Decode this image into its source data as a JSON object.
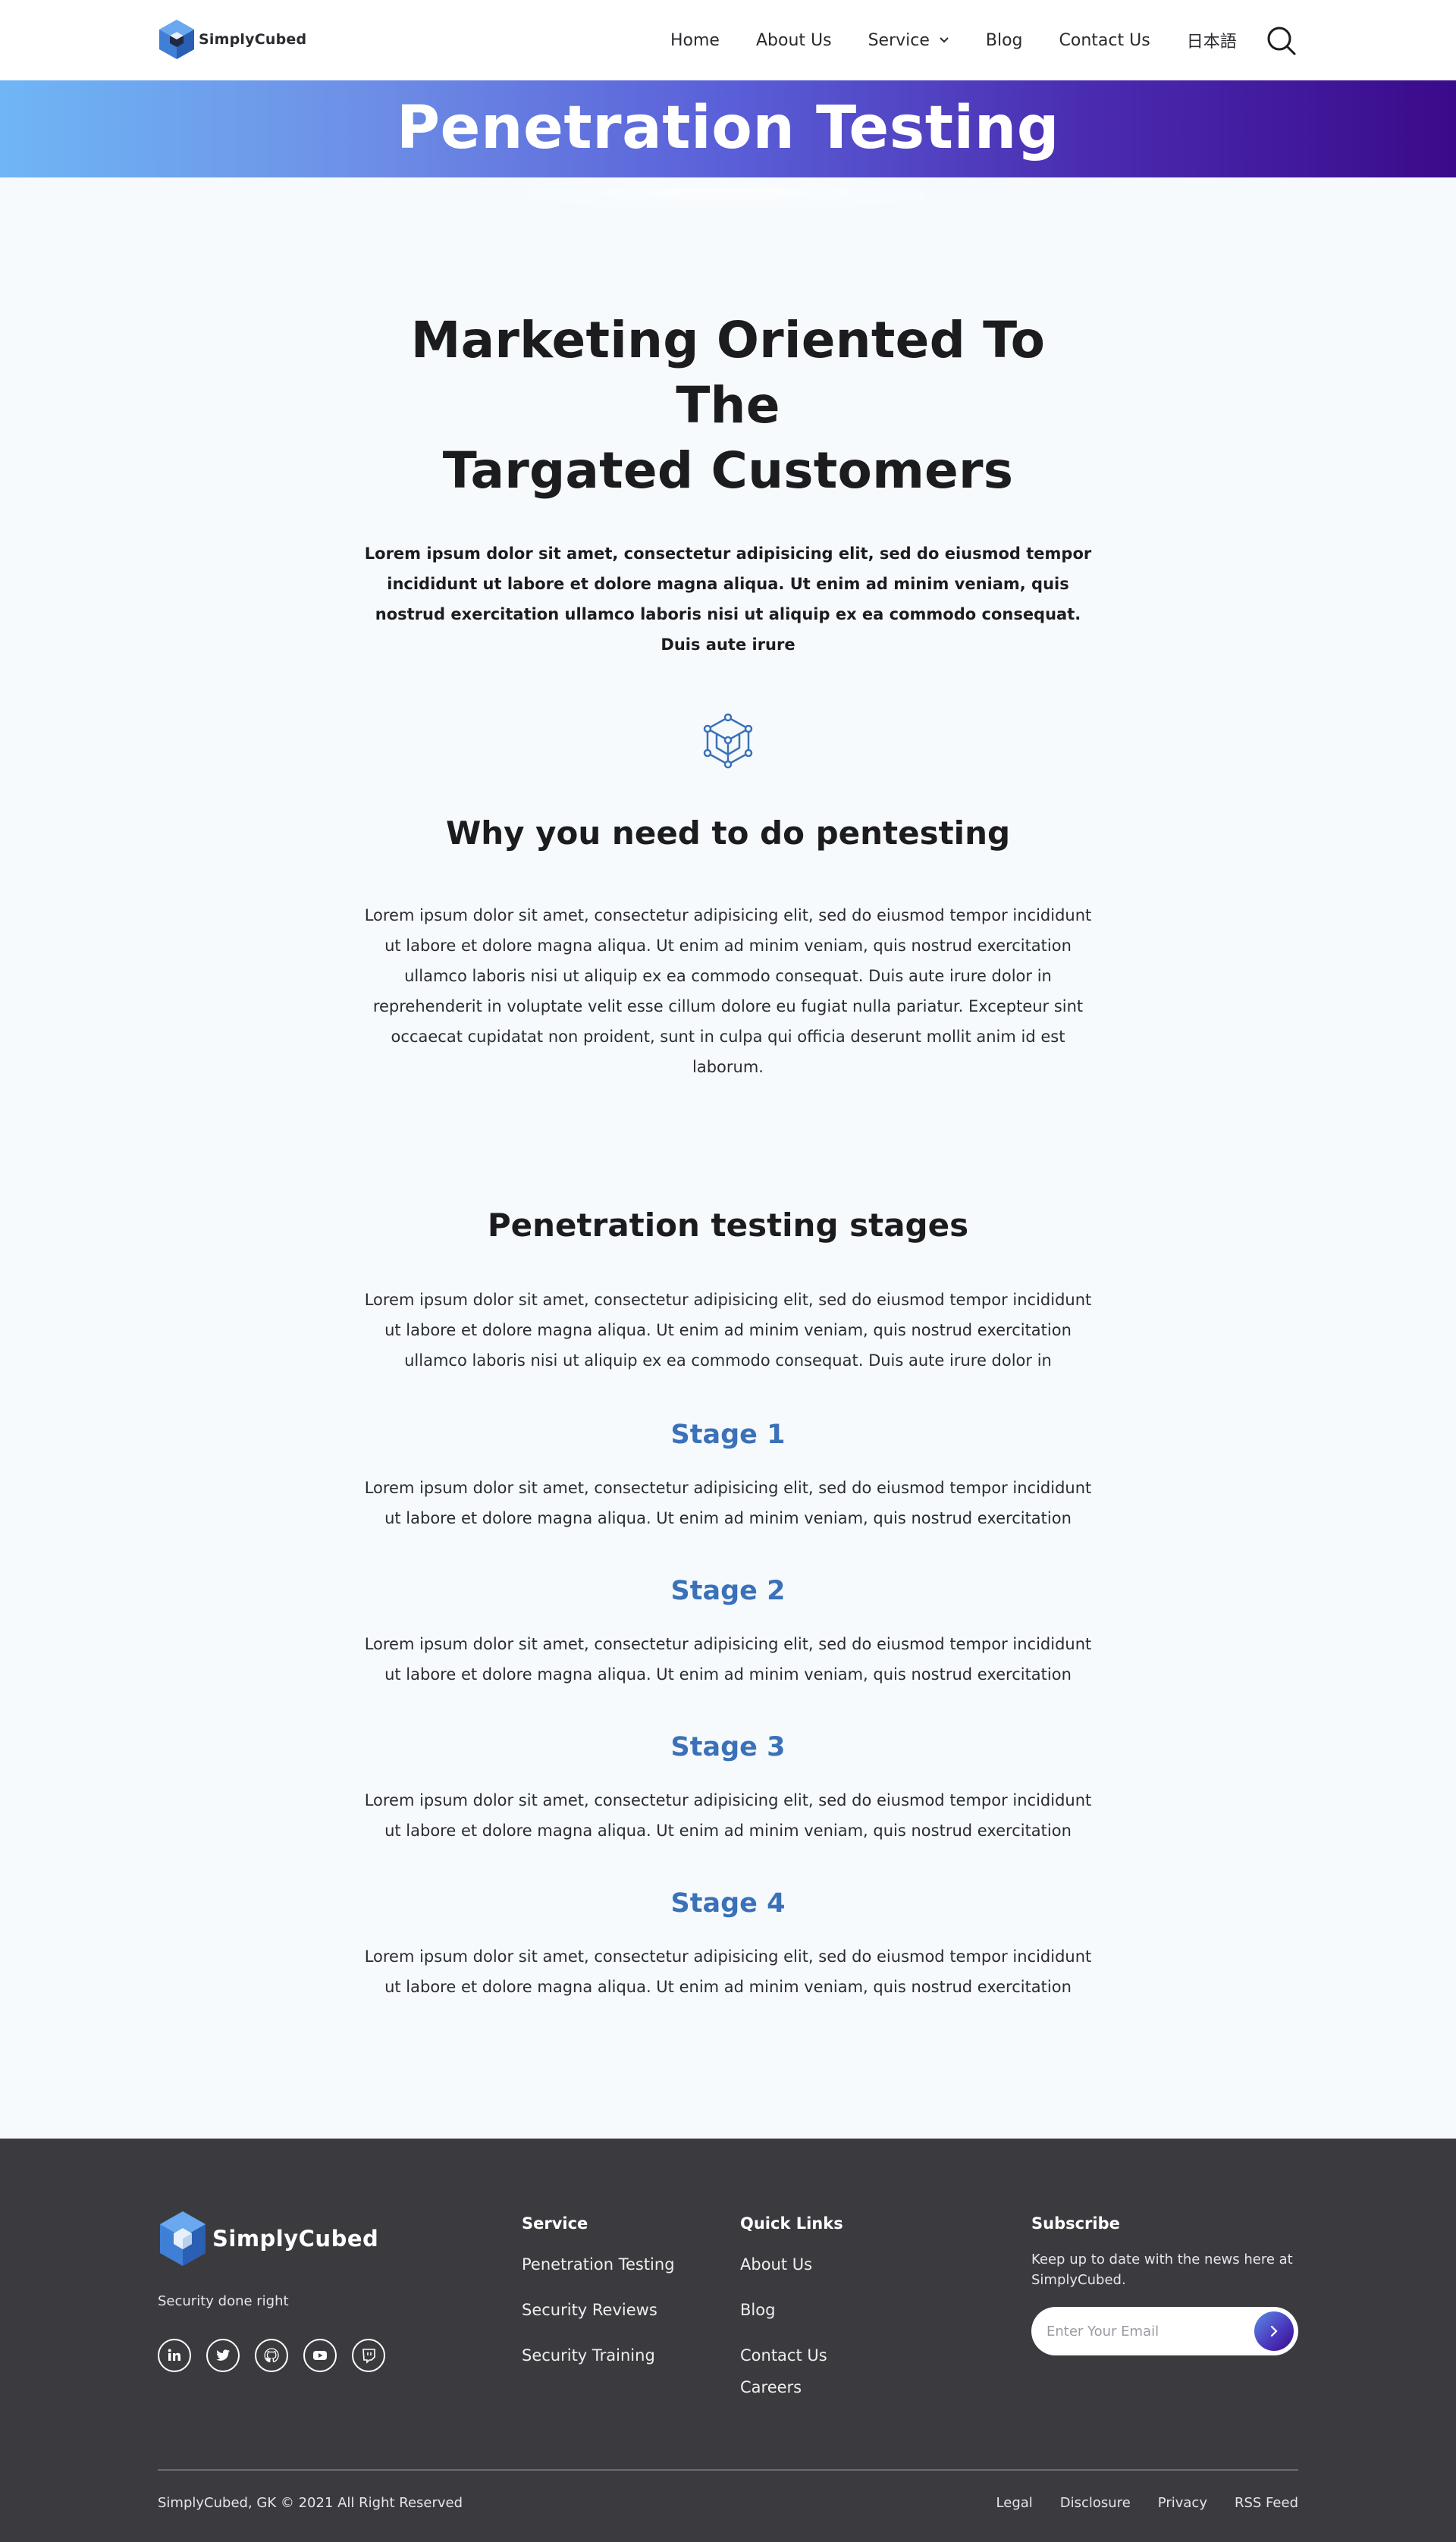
{
  "header": {
    "logo_text": "SimplyCubed",
    "nav": [
      {
        "label": "Home"
      },
      {
        "label": "About Us"
      },
      {
        "label": "Service"
      },
      {
        "label": "Blog"
      },
      {
        "label": "Contact Us"
      },
      {
        "label": "日本語"
      }
    ]
  },
  "hero": {
    "title": "Penetration Testing"
  },
  "intro": {
    "heading_line1": "Marketing Oriented To The",
    "heading_line2": "Targated Customers",
    "lead": "Lorem ipsum dolor sit amet, consectetur adipisicing elit, sed do eiusmod tempor incididunt ut labore et dolore magna aliqua. Ut enim ad minim veniam, quis nostrud exercitation ullamco laboris nisi ut aliquip ex ea commodo consequat. Duis aute irure"
  },
  "why": {
    "heading": "Why you need to do pentesting",
    "body": "Lorem ipsum dolor sit amet, consectetur adipisicing elit, sed do eiusmod tempor incididunt ut labore et dolore magna aliqua. Ut enim ad minim veniam, quis nostrud exercitation ullamco laboris nisi ut aliquip ex ea commodo consequat. Duis aute irure dolor in reprehenderit in voluptate velit esse cillum dolore eu fugiat nulla pariatur. Excepteur sint occaecat cupidatat non proident, sunt in culpa qui officia deserunt mollit anim id est laborum."
  },
  "stages": {
    "heading": "Penetration testing stages",
    "body": "Lorem ipsum dolor sit amet, consectetur adipisicing elit, sed do eiusmod tempor incididunt ut labore et dolore magna aliqua. Ut enim ad minim veniam, quis nostrud exercitation ullamco laboris nisi ut aliquip ex ea commodo consequat. Duis aute irure dolor in",
    "items": [
      {
        "title": "Stage 1",
        "body": "Lorem ipsum dolor sit amet, consectetur adipisicing elit, sed do eiusmod tempor incididunt ut labore et dolore magna aliqua. Ut enim ad minim veniam, quis nostrud exercitation"
      },
      {
        "title": "Stage 2",
        "body": "Lorem ipsum dolor sit amet, consectetur adipisicing elit, sed do eiusmod tempor incididunt ut labore et dolore magna aliqua. Ut enim ad minim veniam, quis nostrud exercitation"
      },
      {
        "title": "Stage 3",
        "body": "Lorem ipsum dolor sit amet, consectetur adipisicing elit, sed do eiusmod tempor incididunt ut labore et dolore magna aliqua. Ut enim ad minim veniam, quis nostrud exercitation"
      },
      {
        "title": "Stage 4",
        "body": "Lorem ipsum dolor sit amet, consectetur adipisicing elit, sed do eiusmod tempor incididunt ut labore et dolore magna aliqua. Ut enim ad minim veniam, quis nostrud exercitation"
      }
    ]
  },
  "footer": {
    "logo_text": "SimplyCubed",
    "tagline": "Security done right",
    "socials": [
      {
        "icon": "linkedin-icon"
      },
      {
        "icon": "twitter-icon"
      },
      {
        "icon": "github-icon"
      },
      {
        "icon": "youtube-icon"
      },
      {
        "icon": "twitch-icon"
      }
    ],
    "service": {
      "heading": "Service",
      "links": [
        "Penetration Testing",
        "Security Reviews",
        "Security Training"
      ]
    },
    "quick_links": {
      "heading": "Quick Links",
      "links": [
        "About Us",
        "Blog",
        "Contact Us",
        "Careers"
      ]
    },
    "subscribe": {
      "heading": "Subscribe",
      "text": "Keep up to date with the news here at SimplyCubed.",
      "placeholder": "Enter Your Email"
    },
    "copyright": "SimplyCubed, GK © 2021 All Right Reserved",
    "legal_links": [
      "Legal",
      "Disclosure",
      "Privacy",
      "RSS Feed"
    ]
  },
  "colors": {
    "accent_blue": "#3a71b8",
    "footer_bg": "#3b3b3f",
    "hero_gradient_start": "#6fb6f5",
    "hero_gradient_end": "#3a0a8a"
  }
}
